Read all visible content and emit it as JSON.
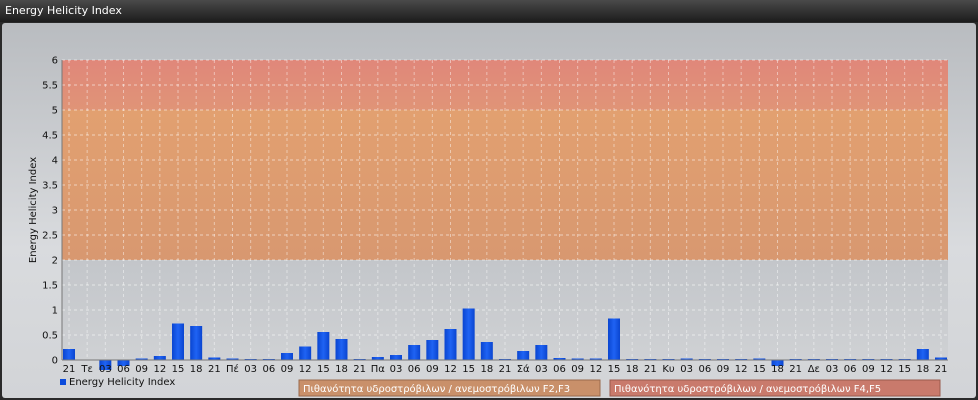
{
  "window": {
    "title": "Energy Helicity Index"
  },
  "colors": {
    "bar": "#0b4bdc",
    "band_low": "#c8cbcf",
    "band_f23": "#dca070",
    "band_f45": "#e08878"
  },
  "chart_data": {
    "type": "bar",
    "ylabel": "Energy Helicity Index",
    "ylim": [
      0,
      6
    ],
    "yticks": [
      "0",
      "0.5",
      "1",
      "1.5",
      "2",
      "2.5",
      "3",
      "3.5",
      "4",
      "4.5",
      "5",
      "5.5",
      "6"
    ],
    "categories": [
      "21",
      "Τε",
      "03",
      "06",
      "09",
      "12",
      "15",
      "18",
      "21",
      "Πέ",
      "03",
      "06",
      "09",
      "12",
      "15",
      "18",
      "21",
      "Πα",
      "03",
      "06",
      "09",
      "12",
      "15",
      "18",
      "21",
      "Σά",
      "03",
      "06",
      "09",
      "12",
      "15",
      "18",
      "21",
      "Κυ",
      "03",
      "06",
      "09",
      "12",
      "15",
      "18",
      "21",
      "Δε",
      "03",
      "06",
      "09",
      "12",
      "15",
      "18",
      "21"
    ],
    "series": [
      {
        "name": "Energy Helicity Index",
        "values": [
          0.22,
          0.01,
          -0.2,
          -0.12,
          0.03,
          0.08,
          0.73,
          0.68,
          0.05,
          0.03,
          0.02,
          0.02,
          0.14,
          0.27,
          0.56,
          0.42,
          0.02,
          0.06,
          0.1,
          0.3,
          0.4,
          0.62,
          1.03,
          0.36,
          0.02,
          0.18,
          0.3,
          0.04,
          0.03,
          0.03,
          0.83,
          0.02,
          0.02,
          0.02,
          0.03,
          0.02,
          0.02,
          0.02,
          0.03,
          -0.12,
          0.02,
          0.02,
          0.02,
          0.02,
          0.02,
          0.02,
          0.02,
          0.22,
          0.05
        ]
      }
    ],
    "bands": [
      {
        "from": 2,
        "to": 5,
        "label": "Πιθανότητα υδροστρόβιλων / ανεμοστρόβιλων F2,F3"
      },
      {
        "from": 5,
        "to": 6,
        "label": "Πιθανότητα υδροστρόβιλων / ανεμοστρόβιλων F4,F5"
      }
    ],
    "grid": true,
    "legend": "bottom"
  }
}
